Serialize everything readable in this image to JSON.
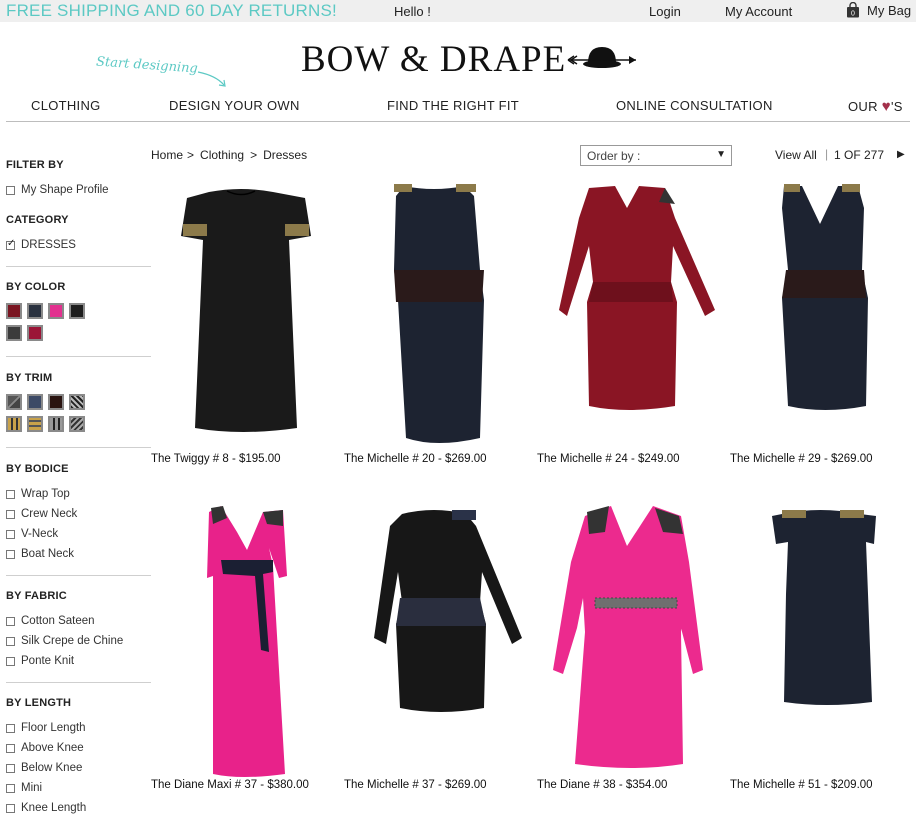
{
  "topbar": {
    "promo": "FREE SHIPPING AND 60 DAY RETURNS!",
    "hello": "Hello !",
    "login": "Login",
    "account": "My Account",
    "bag_label": "My Bag",
    "bag_count": "0"
  },
  "header": {
    "tagline": "Start designing",
    "logo": "BOW & DRAPE"
  },
  "nav": {
    "items": [
      "CLOTHING",
      "DESIGN YOUR OWN",
      "FIND THE RIGHT FIT",
      "ONLINE CONSULTATION"
    ],
    "our_prefix": "OUR",
    "our_suffix": "'S"
  },
  "sidebar": {
    "filter_by": "FILTER BY",
    "shape_profile": "My Shape Profile",
    "category": {
      "title": "CATEGORY",
      "options": [
        "DRESSES"
      ]
    },
    "color": {
      "title": "BY COLOR",
      "swatches": [
        "#7a1521",
        "#2a3240",
        "#e2318f",
        "#1e1e1e",
        "#3b3b3b",
        "#9b1537"
      ]
    },
    "trim": {
      "title": "BY TRIM"
    },
    "bodice": {
      "title": "BY BODICE",
      "options": [
        "Wrap Top",
        "Crew Neck",
        "V-Neck",
        "Boat Neck"
      ]
    },
    "fabric": {
      "title": "BY FABRIC",
      "options": [
        "Cotton Sateen",
        "Silk Crepe de Chine",
        "Ponte Knit"
      ]
    },
    "length": {
      "title": "BY LENGTH",
      "options": [
        "Floor Length",
        "Above Knee",
        "Below Knee",
        "Mini",
        "Knee Length"
      ]
    }
  },
  "breadcrumb": {
    "home": "Home",
    "sep": ">",
    "clothing": "Clothing",
    "dresses": "Dresses"
  },
  "toolbar": {
    "order_by": "Order by :",
    "view_all": "View All",
    "pager": "1 OF 277"
  },
  "products": [
    {
      "caption": "The Twiggy # 8 - $195.00"
    },
    {
      "caption": "The Michelle # 20 - $269.00"
    },
    {
      "caption": "The Michelle # 24 - $249.00"
    },
    {
      "caption": "The Michelle # 29 - $269.00"
    },
    {
      "caption": "The Diane Maxi # 37 - $380.00"
    },
    {
      "caption": "The Michelle # 37 - $269.00"
    },
    {
      "caption": "The Diane # 38 - $354.00"
    },
    {
      "caption": "The Michelle # 51 - $209.00"
    }
  ],
  "colors": {
    "promo": "#5cc9c4",
    "heart": "#a3304b",
    "topbar_bg": "#efefef"
  }
}
